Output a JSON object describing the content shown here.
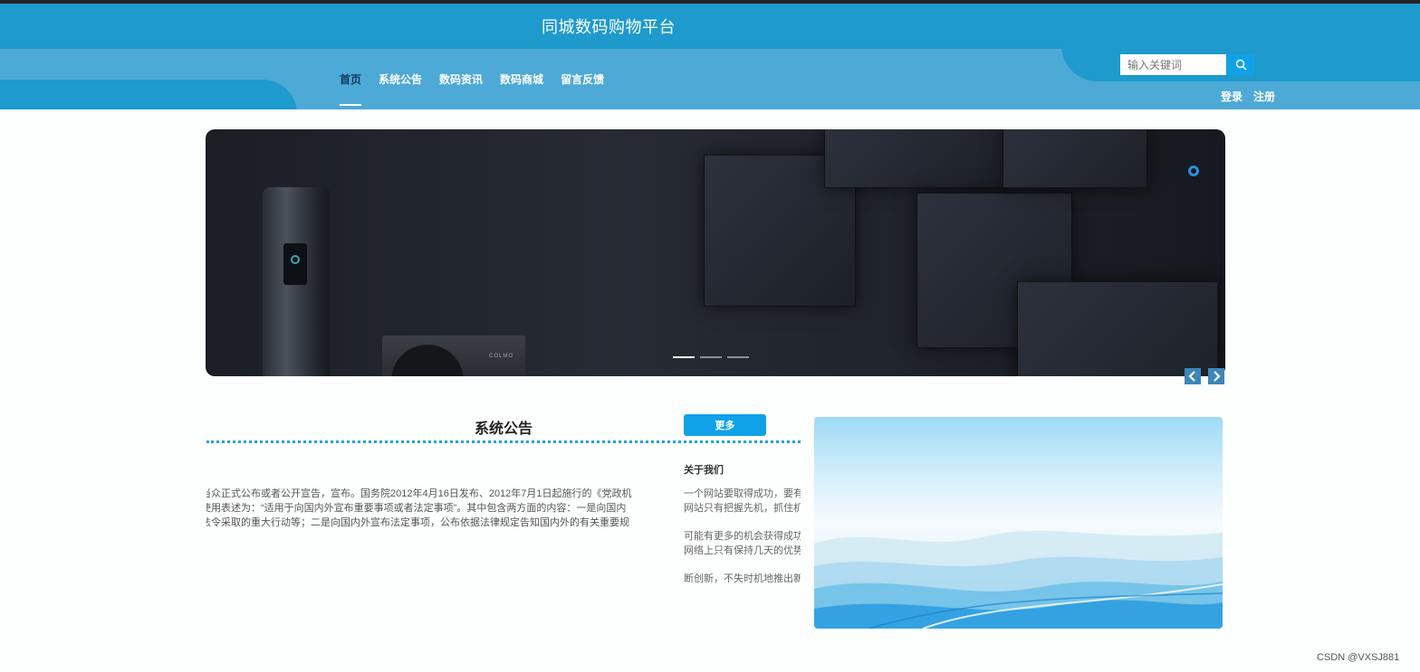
{
  "header": {
    "site_title": "同城数码购物平台",
    "nav": [
      {
        "label": "首页",
        "active": true
      },
      {
        "label": "系统公告",
        "active": false
      },
      {
        "label": "数码资讯",
        "active": false
      },
      {
        "label": "数码商城",
        "active": false
      },
      {
        "label": "留言反馈",
        "active": false
      }
    ],
    "search": {
      "placeholder": "输入关键词",
      "icon": "search-icon"
    },
    "auth": {
      "login": "登录",
      "register": "注册"
    },
    "colors": {
      "primary": "#1e9acc",
      "band": "#4da9d6",
      "button": "#0fa2e8"
    }
  },
  "banner": {
    "slide_count": 3,
    "active_slide": 0,
    "product_brand_text": "COLMO",
    "prev_icon": "chevron-left-icon",
    "next_icon": "chevron-right-icon"
  },
  "notice": {
    "title": "系统公告",
    "more_label": "更多",
    "lines": [
      "重大事件当众正式公布或者公开宣告，宣布。国务院2012年4月16日发布、2012年7月1日起施行的《党政机",
      "关公告的使用表述为：“适用于向国内外宣布重要事项或者法定事项”。其中包含两方面的内容：一是向国内",
      "策政策、法令采取的重大行动等；二是向国内外宣布法定事项，公布依据法律规定告知国内外的有关重要规"
    ]
  },
  "about": {
    "title": "关于我们",
    "paragraphs": [
      [
        "一个网站要取得成功，要有",
        "网站只有把握先机，抓住机"
      ],
      [
        "可能有更多的机会获得成功",
        "网络上只有保持几天的优势"
      ],
      [
        "断创新，不失时机地推出新"
      ]
    ]
  },
  "watermark": "CSDN @VXSJ881"
}
